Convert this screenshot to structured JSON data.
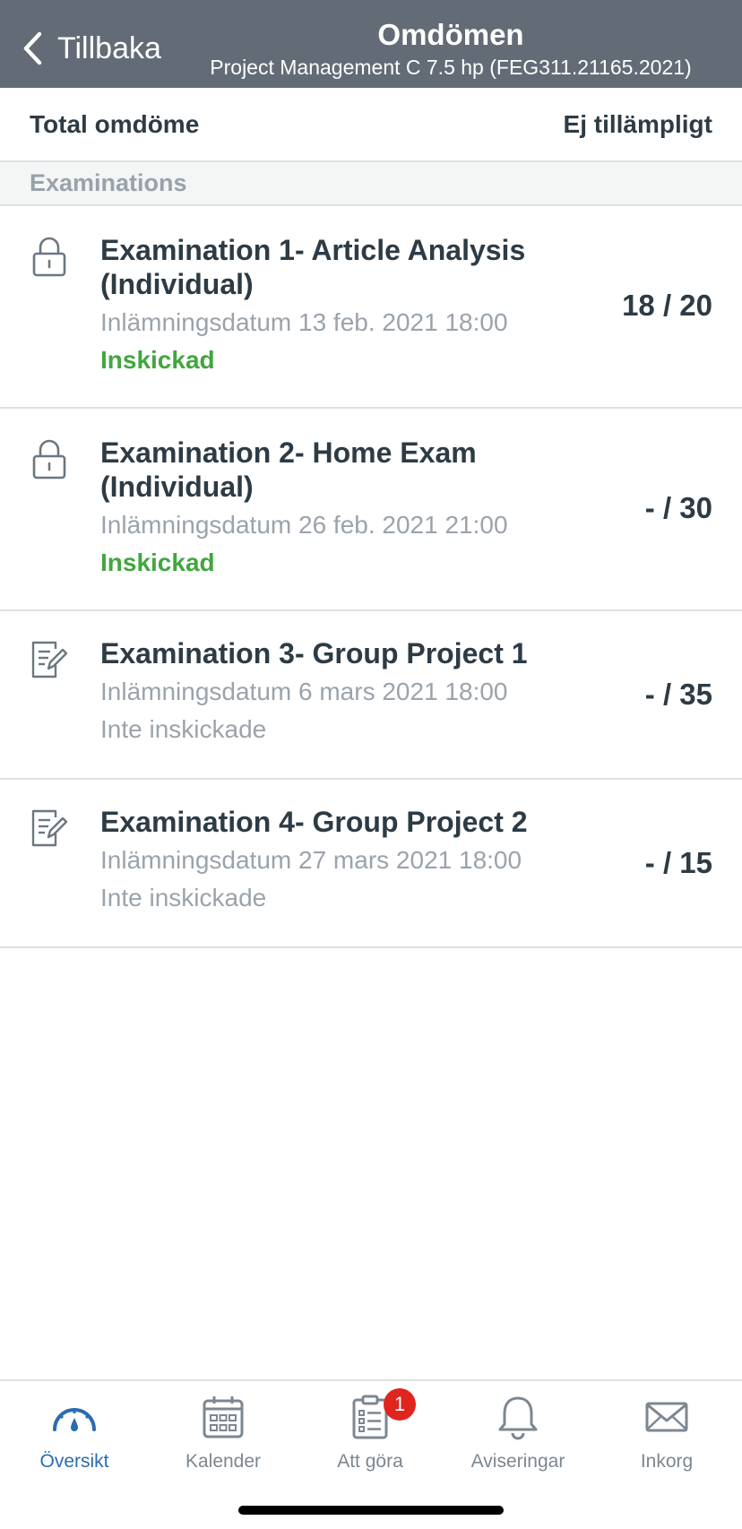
{
  "header": {
    "back_label": "Tillbaka",
    "title": "Omdömen",
    "subtitle": "Project Management C 7.5 hp (FEG311.21165.2021)"
  },
  "total": {
    "label": "Total omdöme",
    "value": "Ej tillämpligt"
  },
  "section": {
    "title": "Examinations"
  },
  "assignments": [
    {
      "title": "Examination 1- Article Analysis (Individual)",
      "date": "Inlämningsdatum 13 feb. 2021 18:00",
      "status": "Inskickad",
      "score": "18 / 20",
      "icon": "lock-icon"
    },
    {
      "title": "Examination 2- Home Exam (Individual)",
      "date": "Inlämningsdatum 26 feb. 2021 21:00",
      "status": "Inskickad",
      "score": "- / 30",
      "icon": "lock-icon"
    },
    {
      "title": "Examination 3- Group Project 1",
      "date": "Inlämningsdatum 6 mars 2021 18:00",
      "status": "Inte inskickade",
      "score": "- / 35",
      "icon": "assignment-icon"
    },
    {
      "title": "Examination 4- Group Project 2",
      "date": "Inlämningsdatum 27 mars 2021 18:00",
      "status": "Inte inskickade",
      "score": "- / 15",
      "icon": "assignment-icon"
    }
  ],
  "tabbar": {
    "tabs": [
      {
        "label": "Översikt",
        "icon": "dashboard-icon",
        "active": true
      },
      {
        "label": "Kalender",
        "icon": "calendar-icon",
        "active": false
      },
      {
        "label": "Att göra",
        "icon": "todo-icon",
        "active": false,
        "badge": "1"
      },
      {
        "label": "Aviseringar",
        "icon": "bell-icon",
        "active": false
      },
      {
        "label": "Inkorg",
        "icon": "mail-icon",
        "active": false
      }
    ]
  },
  "colors": {
    "header_bg": "#636b76",
    "submitted": "#42a63e",
    "muted": "#9ba3ab",
    "active_tab": "#2b6cb0",
    "badge": "#e0251f"
  }
}
